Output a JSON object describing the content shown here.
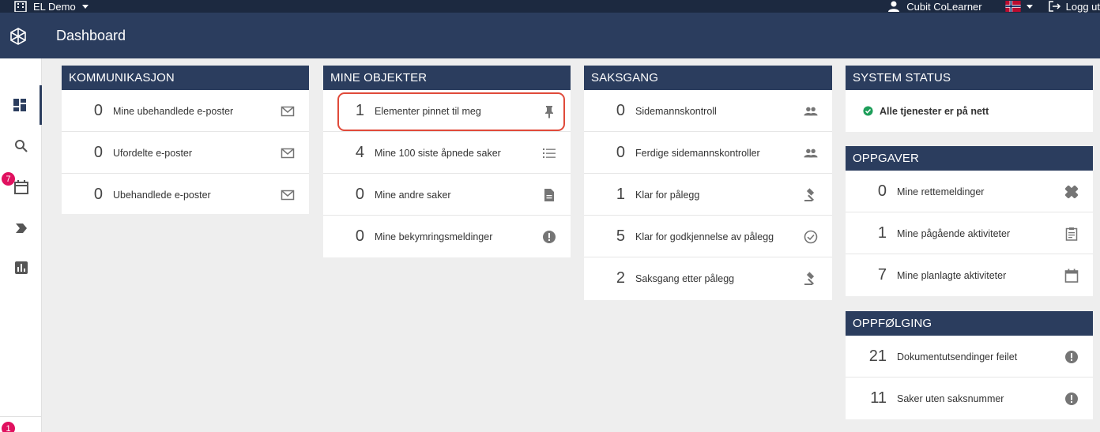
{
  "topbar": {
    "org_name": "EL Demo",
    "user_name": "Cubit CoLearner",
    "logout_label": "Logg ut"
  },
  "header": {
    "title": "Dashboard"
  },
  "sidebar": {
    "items": [
      {
        "icon": "dashboard-icon"
      },
      {
        "icon": "search-icon"
      },
      {
        "icon": "calendar-icon",
        "badge": "7"
      },
      {
        "icon": "label-arrow-icon"
      },
      {
        "icon": "bar-chart-icon"
      }
    ],
    "bottom_badge": "1"
  },
  "cards": {
    "kommunikasjon": {
      "title": "KOMMUNIKASJON",
      "rows": [
        {
          "count": "0",
          "label": "Mine ubehandlede e-poster",
          "icon": "mail-icon"
        },
        {
          "count": "0",
          "label": "Ufordelte e-poster",
          "icon": "mail-icon"
        },
        {
          "count": "0",
          "label": "Ubehandlede e-poster",
          "icon": "mail-icon"
        }
      ]
    },
    "mine_objekter": {
      "title": "MINE OBJEKTER",
      "rows": [
        {
          "count": "1",
          "label": "Elementer pinnet til meg",
          "icon": "pin-icon"
        },
        {
          "count": "4",
          "label": "Mine 100 siste åpnede saker",
          "icon": "list-icon"
        },
        {
          "count": "0",
          "label": "Mine andre saker",
          "icon": "document-icon"
        },
        {
          "count": "0",
          "label": "Mine bekymringsmeldinger",
          "icon": "alert-icon"
        }
      ]
    },
    "saksgang": {
      "title": "SAKSGANG",
      "rows": [
        {
          "count": "0",
          "label": "Sidemannskontroll",
          "icon": "people-icon"
        },
        {
          "count": "0",
          "label": "Ferdige sidemannskontroller",
          "icon": "people-icon"
        },
        {
          "count": "1",
          "label": "Klar for pålegg",
          "icon": "gavel-icon"
        },
        {
          "count": "5",
          "label": "Klar for godkjennelse av pålegg",
          "icon": "check-circle-icon"
        },
        {
          "count": "2",
          "label": "Saksgang etter pålegg",
          "icon": "gavel-icon"
        }
      ]
    },
    "system_status": {
      "title": "SYSTEM STATUS",
      "status_text": "Alle tjenester er på nett",
      "status_color": "#1e9e5a"
    },
    "oppgaver": {
      "title": "OPPGAVER",
      "rows": [
        {
          "count": "0",
          "label": "Mine rettemeldinger",
          "icon": "bandage-icon"
        },
        {
          "count": "1",
          "label": "Mine pågående aktiviteter",
          "icon": "clipboard-icon"
        },
        {
          "count": "7",
          "label": "Mine planlagte aktiviteter",
          "icon": "calendar-icon"
        }
      ]
    },
    "oppfolging": {
      "title": "OPPFØLGING",
      "rows": [
        {
          "count": "21",
          "label": "Dokumentutsendinger feilet",
          "icon": "alert-icon"
        },
        {
          "count": "11",
          "label": "Saker uten saksnummer",
          "icon": "alert-icon"
        }
      ]
    }
  },
  "colors": {
    "topbar": "#1c2940",
    "header": "#2b3d5e",
    "card_header": "#2b3d5e",
    "badge": "#e0115f",
    "highlight": "#e04a3a",
    "icon": "#757575"
  }
}
